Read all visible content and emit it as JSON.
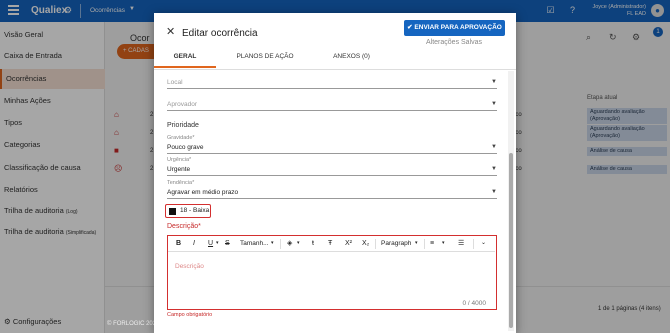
{
  "topbar": {
    "logo": "Qualiex",
    "module": "Ocorrências",
    "user_name": "Joyce (Administrador)",
    "user_company": "FL EAD"
  },
  "sidebar": {
    "items": [
      {
        "label": "Visão Geral"
      },
      {
        "label": "Caixa de Entrada"
      },
      {
        "label": "Ocorrências"
      },
      {
        "label": "Minhas Ações"
      },
      {
        "label": "Tipos"
      },
      {
        "label": "Categorias"
      },
      {
        "label": "Classificação de causa"
      },
      {
        "label": "Relatórios"
      },
      {
        "label": "Trilha de auditoria",
        "note": "(Log)"
      },
      {
        "label": "Trilha de auditoria",
        "note": "(Simplificada)"
      }
    ],
    "config": "Configurações"
  },
  "background": {
    "title": "Ocor",
    "new_button": "+ CADAS",
    "col_header": "Etapa atual",
    "rows": [
      {
        "n": "2",
        "col": "nco",
        "badge": "Aguardando avaliação (Aprovação)"
      },
      {
        "n": "2",
        "col": "nco",
        "badge": "Aguardando avaliação (Aprovação)"
      },
      {
        "n": "2",
        "col": "nco",
        "badge": "Análise de causa"
      },
      {
        "n": "2",
        "col": "nco",
        "badge": "Análise de causa"
      }
    ],
    "pager_text": "1 de 1 páginas (4 itens)",
    "copyright": "© FORLOGIC 2025",
    "badge_count": "1"
  },
  "dialog": {
    "title": "Editar ocorrência",
    "send_button": "ENVIAR PARA APROVAÇÃO",
    "saved_status": "Alterações Salvas",
    "tabs": [
      {
        "label": "GERAL",
        "active": true
      },
      {
        "label": "PLANOS DE AÇÃO",
        "active": false
      },
      {
        "label": "ANEXOS (0)",
        "active": false
      }
    ],
    "fields": {
      "local": {
        "placeholder": "Local"
      },
      "aprovador": {
        "placeholder": "Aprovador"
      },
      "section_title": "Prioridade",
      "gravidade": {
        "label": "Gravidade*",
        "value": "Pouco grave"
      },
      "urgencia": {
        "label": "Urgência*",
        "value": "Urgente"
      },
      "tendencia": {
        "label": "Tendência*",
        "value": "Agravar em médio prazo"
      }
    },
    "risk": {
      "value": "18 - Baixa",
      "color": "#111111"
    },
    "description": {
      "label": "Descrição*",
      "placeholder": "Descrição",
      "counter": "0 / 4000",
      "error": "Campo obrigatório"
    },
    "toolbar": {
      "font_size_label": "Tamanh...",
      "paragraph_label": "Paragraph"
    }
  },
  "colors": {
    "primary": "#1565c0",
    "accent": "#e0661e",
    "error": "#d32f2f"
  }
}
